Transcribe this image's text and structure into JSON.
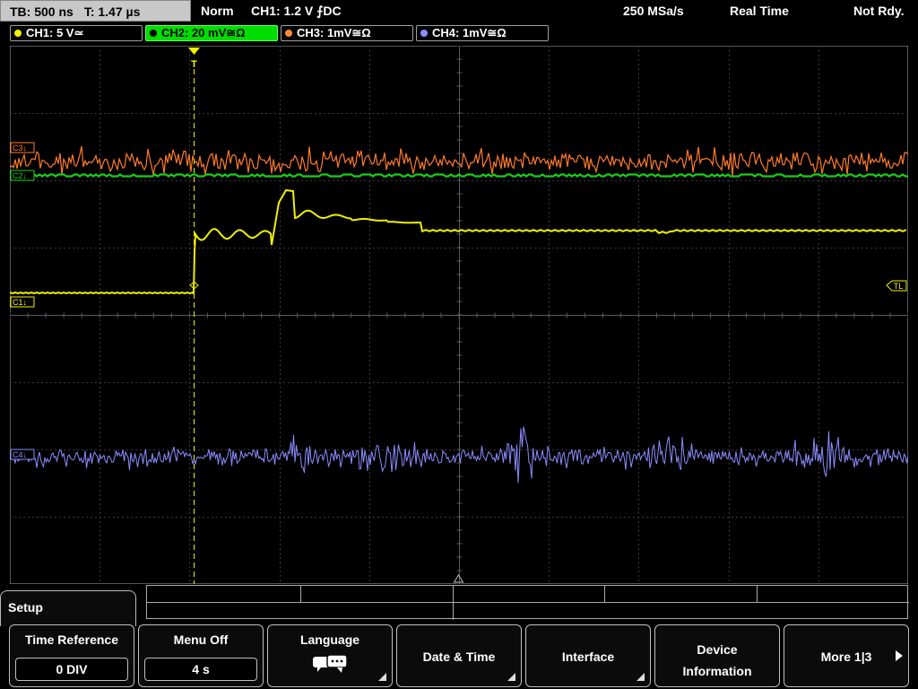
{
  "status_bar": {
    "timebase": "TB: 500 ns",
    "trigger_time": "T: 1.47 µs",
    "mode": "Norm",
    "trigger": "CH1: 1.2 V ⨍DC",
    "sample_rate": "250 MSa/s",
    "acquisition": "Real Time",
    "state": "Not Rdy."
  },
  "channels": [
    {
      "label": "CH1: 5 V≃",
      "color": "#f0f000",
      "active": false
    },
    {
      "label": "CH2: 20 mV≅Ω",
      "color": "#00cc00",
      "active": true
    },
    {
      "label": "CH3: 1mV≅Ω",
      "color": "#ff8c33",
      "active": false
    },
    {
      "label": "CH4: 1mV≅Ω",
      "color": "#8c8cff",
      "active": false
    }
  ],
  "markers": {
    "ch3": "C3↓",
    "ch2": "C2↓",
    "ch1": "C1↓",
    "ch4": "C4↓",
    "trigger_level": "TL",
    "trigger_pos": "T"
  },
  "traces": {
    "ch1_color": "#f0f000",
    "ch2_color": "#18d018",
    "ch3_color": "#ff7b2a",
    "ch4_color": "#8c8cff"
  },
  "menu": {
    "title": "Setup",
    "softkeys": [
      {
        "label": "Time Reference",
        "value": "0 DIV"
      },
      {
        "label": "Menu Off",
        "value": "4 s"
      },
      {
        "label": "Language",
        "icon": "speech-bubbles-icon"
      },
      {
        "label": "Date & Time"
      },
      {
        "label": "Interface"
      },
      {
        "label": "Device Information"
      },
      {
        "label": "More 1|3"
      }
    ]
  }
}
